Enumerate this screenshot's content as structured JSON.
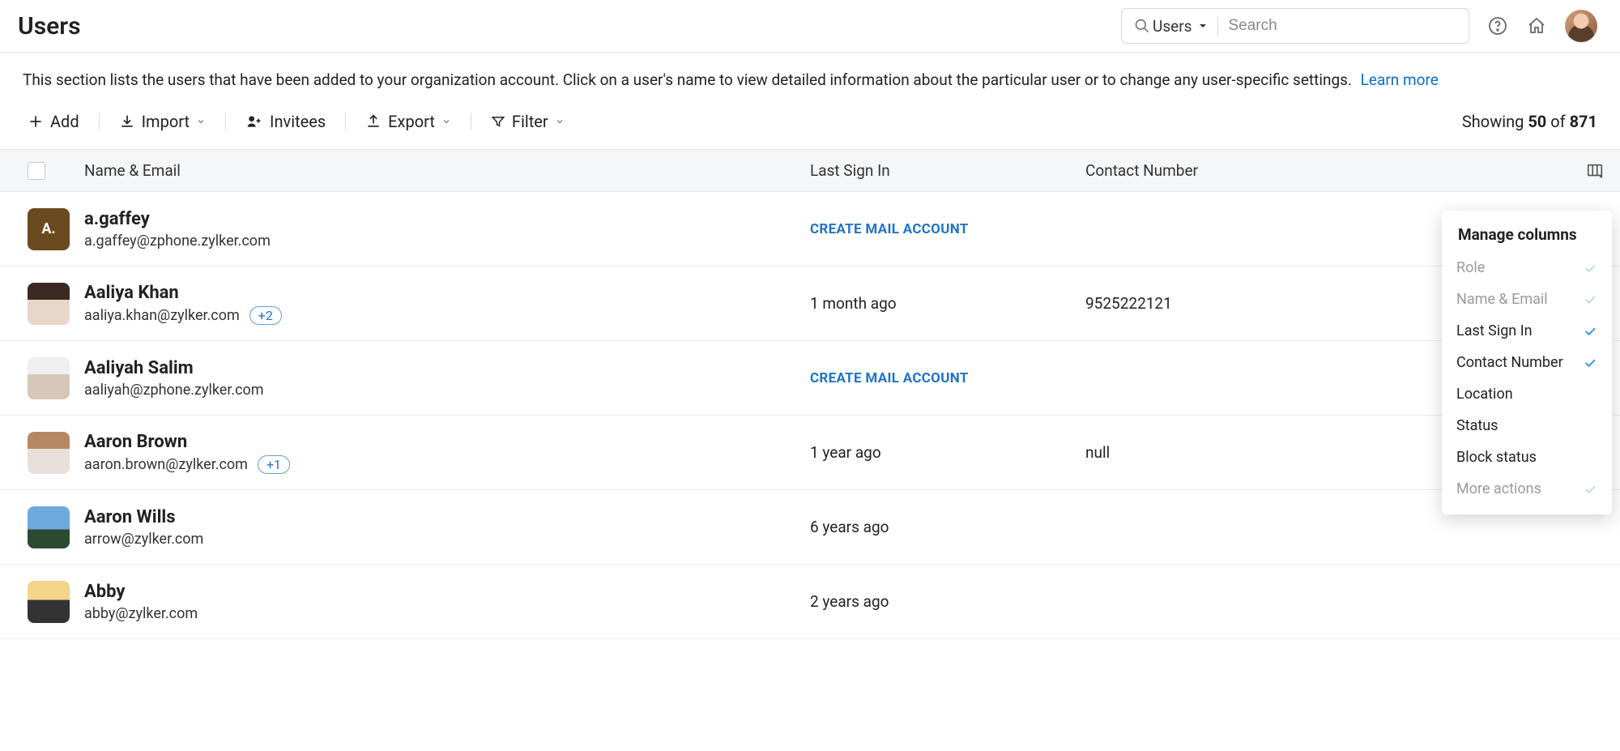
{
  "header": {
    "title": "Users",
    "search_scope": "Users",
    "search_placeholder": "Search"
  },
  "description": {
    "text": "This section lists the users that have been added to your organization account. Click on a user's name to view detailed information about the particular user or to change any user-specific settings.",
    "learn_more": "Learn more"
  },
  "toolbar": {
    "add": "Add",
    "import": "Import",
    "invitees": "Invitees",
    "export": "Export",
    "filter": "Filter",
    "showing_prefix": "Showing ",
    "showing_count": "50",
    "showing_of": " of ",
    "showing_total": "871"
  },
  "columns": {
    "name_email": "Name & Email",
    "last_signin": "Last Sign In",
    "contact_number": "Contact Number"
  },
  "create_mail_label": "CREATE MAIL ACCOUNT",
  "rows": [
    {
      "avatar_type": "initial",
      "avatar_class": "av-brown",
      "initial": "A.",
      "name": "a.gaffey",
      "email": "a.gaffey@zphone.zylker.com",
      "badge": "",
      "signin_type": "create",
      "contact": ""
    },
    {
      "avatar_type": "photo",
      "avatar_class": "av-photo1",
      "initial": "",
      "name": "Aaliya Khan",
      "email": "aaliya.khan@zylker.com",
      "badge": "+2",
      "signin_type": "text",
      "signin": "1 month ago",
      "contact": "9525222121"
    },
    {
      "avatar_type": "photo",
      "avatar_class": "av-photo2",
      "initial": "",
      "name": "Aaliyah Salim",
      "email": "aaliyah@zphone.zylker.com",
      "badge": "",
      "signin_type": "create",
      "contact": ""
    },
    {
      "avatar_type": "photo",
      "avatar_class": "av-photo3",
      "initial": "",
      "name": "Aaron Brown",
      "email": "aaron.brown@zylker.com",
      "badge": "+1",
      "signin_type": "text",
      "signin": "1 year ago",
      "contact": "null"
    },
    {
      "avatar_type": "photo",
      "avatar_class": "av-photo4",
      "initial": "",
      "name": "Aaron Wills",
      "email": "arrow@zylker.com",
      "badge": "",
      "signin_type": "text",
      "signin": "6 years ago",
      "contact": ""
    },
    {
      "avatar_type": "photo",
      "avatar_class": "av-photo5",
      "initial": "",
      "name": "Abby",
      "email": "abby@zylker.com",
      "badge": "",
      "signin_type": "text",
      "signin": "2 years ago",
      "contact": ""
    }
  ],
  "popover": {
    "title": "Manage columns",
    "items": [
      {
        "label": "Role",
        "checked": true,
        "muted": true
      },
      {
        "label": "Name & Email",
        "checked": true,
        "muted": true
      },
      {
        "label": "Last Sign In",
        "checked": true,
        "muted": false
      },
      {
        "label": "Contact Number",
        "checked": true,
        "muted": false
      },
      {
        "label": "Location",
        "checked": false,
        "muted": false
      },
      {
        "label": "Status",
        "checked": false,
        "muted": false
      },
      {
        "label": "Block status",
        "checked": false,
        "muted": false
      },
      {
        "label": "More actions",
        "checked": true,
        "muted": true
      }
    ]
  }
}
